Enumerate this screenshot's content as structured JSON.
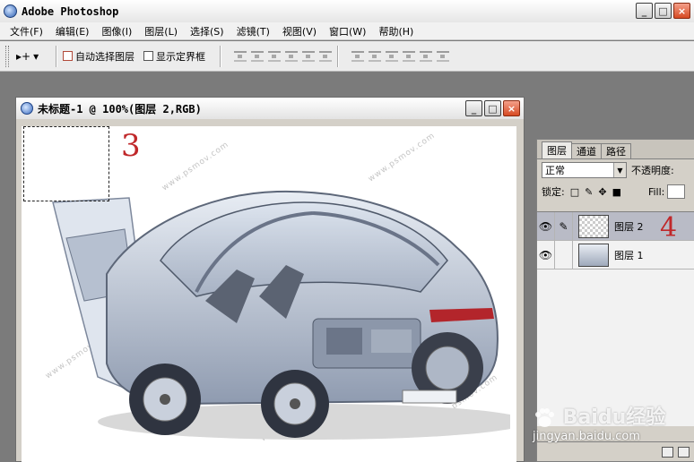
{
  "app": {
    "title": "Adobe Photoshop",
    "window_buttons": [
      "_",
      "□",
      "×"
    ]
  },
  "menu": [
    "文件(F)",
    "编辑(E)",
    "图像(I)",
    "图层(L)",
    "选择(S)",
    "滤镜(T)",
    "视图(V)",
    "窗口(W)",
    "帮助(H)"
  ],
  "options": {
    "move_tool_label": "▸+",
    "auto_select_label": "自动选择图层",
    "show_bounds_label": "显示定界框"
  },
  "document": {
    "title": "未标题-1 @ 100%(图层 2,RGB)",
    "annotation_3": "3",
    "watermark_text": "www.psmov.com"
  },
  "layers_panel": {
    "tabs": [
      "图层",
      "通道",
      "路径"
    ],
    "blend_mode": "正常",
    "opacity_label": "不透明度:",
    "lock_label": "锁定:",
    "fill_label": "Fill:",
    "layers": [
      {
        "name": "图层 2",
        "selected": true
      },
      {
        "name": "图层 1",
        "selected": false
      }
    ],
    "annotation_4": "4"
  },
  "watermark": {
    "logo": "Baidu经验",
    "url": "jingyan.baidu.com"
  },
  "colors": {
    "annotation_red": "#c0282a",
    "selected_layer": "#b9bbc6",
    "workspace": "#7b7b7b"
  }
}
